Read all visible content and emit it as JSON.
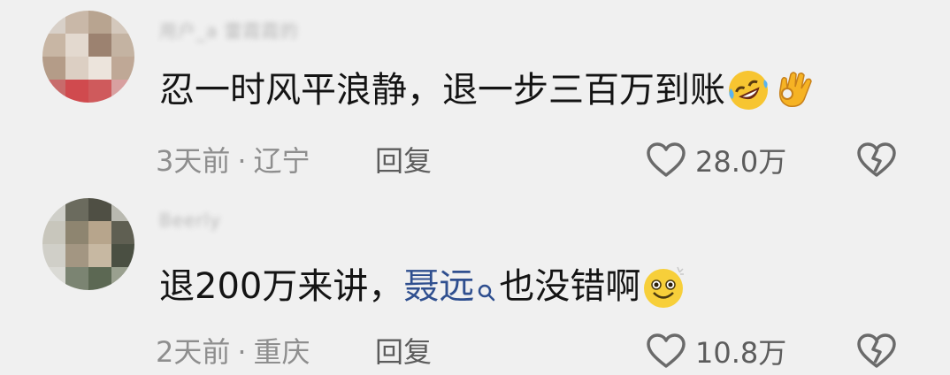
{
  "comments": [
    {
      "username": "用户_a 雷霞霞的",
      "text": "忍一时风平浪静，退一步三百万到账",
      "emojis": [
        "rofl-emoji",
        "ok-hand-emoji"
      ],
      "time": "3天前",
      "separator": "·",
      "location": "辽宁",
      "reply_label": "回复",
      "like_count": "28.0万"
    },
    {
      "username": "Beerly",
      "text_before": "退200万来讲，",
      "mention": "聂远",
      "text_after": "也没错啊",
      "emojis": [
        "grin-emoji"
      ],
      "time": "2天前",
      "separator": "·",
      "location": "重庆",
      "reply_label": "回复",
      "like_count": "10.8万"
    }
  ],
  "colors": {
    "background": "#f0f0f0",
    "text": "#141414",
    "meta": "#8e8e8e",
    "mention": "#2f4f8f"
  }
}
